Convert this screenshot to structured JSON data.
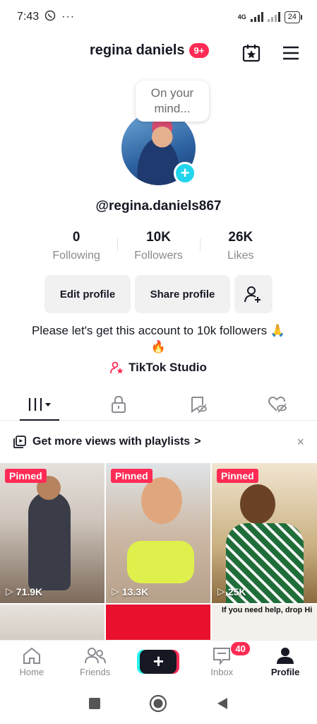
{
  "status_bar": {
    "time": "7:43",
    "network_label": "4G",
    "battery": "24"
  },
  "header": {
    "username": "regina daniels",
    "notifications_badge": "9+"
  },
  "profile": {
    "bubble_text": "On your mind...",
    "handle": "@regina.daniels867",
    "stats": [
      {
        "value": "0",
        "label": "Following"
      },
      {
        "value": "10K",
        "label": "Followers"
      },
      {
        "value": "26K",
        "label": "Likes"
      }
    ],
    "edit_profile_label": "Edit profile",
    "share_profile_label": "Share profile",
    "bio": "Please let's get this account to 10k followers 🙏🔥",
    "studio_label": "TikTok Studio"
  },
  "playlist_banner": {
    "text": "Get more views with playlists",
    "chevron": ">",
    "close": "×"
  },
  "videos": [
    {
      "pinned_label": "Pinned",
      "views": "71.9K"
    },
    {
      "pinned_label": "Pinned",
      "views": "13.3K"
    },
    {
      "pinned_label": "Pinned",
      "views": "25K"
    },
    {
      "caption": ""
    },
    {
      "caption": ""
    },
    {
      "caption": "If you need help, drop Hi"
    }
  ],
  "bottom_nav": {
    "items": [
      {
        "label": "Home",
        "icon": "home-icon"
      },
      {
        "label": "Friends",
        "icon": "friends-icon"
      },
      {
        "label": "",
        "icon": "create-icon"
      },
      {
        "label": "Inbox",
        "icon": "inbox-icon"
      },
      {
        "label": "Profile",
        "icon": "profile-icon"
      }
    ],
    "create_symbol": "+",
    "inbox_badge": "40"
  },
  "colors": {
    "accent": "#fe2c55",
    "cyan": "#20d5ec",
    "text": "#161823",
    "muted": "#8a8b91"
  }
}
